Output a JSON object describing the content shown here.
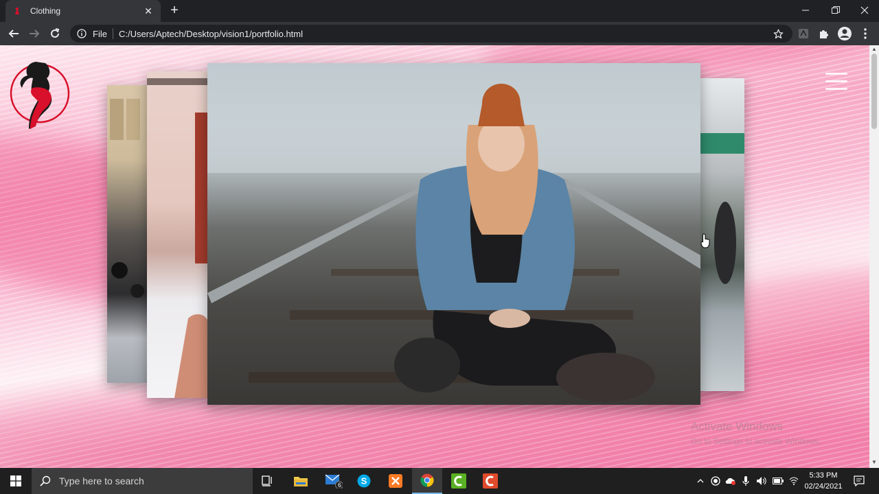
{
  "browser": {
    "tab_title": "Clothing",
    "scheme_label": "File",
    "url": "C:/Users/Aptech/Desktop/vision1/portfolio.html"
  },
  "page": {
    "watermark_line1": "Activate Windows",
    "watermark_line2": "Go to Settings to activate Windows."
  },
  "taskbar": {
    "search_placeholder": "Type here to search",
    "mail_badge": "6",
    "time": "5:33 PM",
    "date": "02/24/2021"
  },
  "colors": {
    "chrome_dark": "#202124",
    "chrome_toolbar": "#35363a",
    "brand_red": "#d8102b",
    "page_pink": "#f7a8c4",
    "taskbar": "#1f1f1f"
  }
}
